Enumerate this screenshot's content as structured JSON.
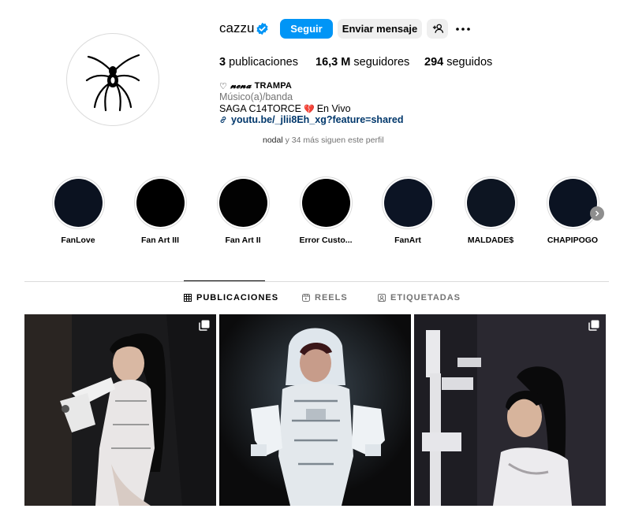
{
  "profile": {
    "username": "cazzu",
    "verified": true,
    "follow_label": "Seguir",
    "message_label": "Enviar mensaje",
    "stats": {
      "posts_count": "3",
      "posts_label": "publicaciones",
      "followers_count": "16,3 M",
      "followers_label": "seguidores",
      "following_count": "294",
      "following_label": "seguidos"
    },
    "nickname_prefix": "♡",
    "nickname_styled": "𝓷𝓮𝓷𝓪",
    "nickname_rest": "TRAMPA",
    "category": "Músico(a)/banda",
    "bio_text": "SAGA C14TORCE",
    "bio_emoji": "💔",
    "bio_suffix": "En Vivo",
    "link": "youtu.be/_jlii8Eh_xg?feature=shared",
    "followed_by_name": "nodal",
    "followed_by_rest": "y 34 más siguen este perfil"
  },
  "highlights": [
    {
      "label": "FanLove",
      "color": "#0b1220"
    },
    {
      "label": "Fan Art III",
      "color": "#000000"
    },
    {
      "label": "Fan Art II",
      "color": "#020202"
    },
    {
      "label": "Error Custo...",
      "color": "#000000"
    },
    {
      "label": "FanArt",
      "color": "#0c1424"
    },
    {
      "label": "MALDADE$",
      "color": "#0d1522"
    },
    {
      "label": "CHAPIPOGO",
      "color": "#0b1322"
    }
  ],
  "tabs": [
    {
      "label": "PUBLICACIONES",
      "icon": "grid-icon",
      "active": true
    },
    {
      "label": "REELS",
      "icon": "reels-icon",
      "active": false
    },
    {
      "label": "ETIQUETADAS",
      "icon": "tagged-icon",
      "active": false
    }
  ],
  "colors": {
    "accent": "#0095f6",
    "link": "#00376b",
    "muted": "#737373",
    "secondary_btn": "#efefef"
  }
}
